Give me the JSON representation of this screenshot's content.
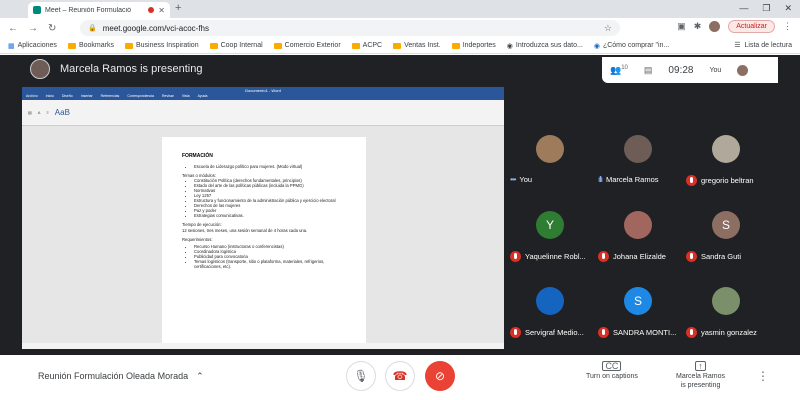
{
  "browser": {
    "tab_title": "Meet – Reunión Formulació",
    "url": "meet.google.com/vci-acoc-fhs",
    "update_label": "Actualizar"
  },
  "bookmarks": {
    "items": [
      "Aplicaciones",
      "Bookmarks",
      "Business Inspiration",
      "Coop Internal",
      "Comercio Exterior",
      "ACPC",
      "Ventas Inst.",
      "Indeportes",
      "Introduzca sus dato...",
      "¿Cómo comprar \"in..."
    ],
    "reading_list": "Lista de lectura"
  },
  "meet": {
    "presenting_text": "Marcela Ramos is presenting",
    "people_count": "10",
    "time": "09:28",
    "you_label": "You"
  },
  "document": {
    "app_title": "Documento1 - Word",
    "tabs": [
      "Archivo",
      "Inicio",
      "Diseño",
      "Insertar",
      "Referencias",
      "Correspondencia",
      "Revisar",
      "Vista",
      "Ayuda"
    ],
    "ribbon_big": "AaB",
    "heading": "FORMACIÓN",
    "intro_bullet": "Escuela de Liderazgo político para mujeres. (Modo virtual)",
    "topics_title": "Temas o módulos:",
    "topics": [
      "Constitución Política (derechos fundamentales, principios)",
      "Estado del arte de las políticas públicas (incluida la PPMG)",
      "Normativas",
      "Ley 1257",
      "Estructura y funcionamiento de la administración pública y ejercicio electoral",
      "Derechos de las mujeres",
      "Paz y poder",
      "Estrategias comunicativas."
    ],
    "time_title": "Tiempo de ejecución:",
    "time_text": "12 sesiones, tres meses, una sesión semanal de 4 horas cada una.",
    "req_title": "Requerimientos:",
    "requirements": [
      "Recurso Humano (instructoras o conferencistas)",
      "Coordinadora logística",
      "Publicidad para convocatoria",
      "Temas logísticos (transporte, sitio o plataforma, materiales, refrigerios, certificaciones, etc)."
    ]
  },
  "participants": [
    {
      "name": "You",
      "initial": "",
      "color": "#9e7b5a",
      "muted": false
    },
    {
      "name": "Marcela Ramos",
      "initial": "",
      "color": "#6d5d56",
      "muted": false
    },
    {
      "name": "gregorio beltran",
      "initial": "",
      "color": "#b0a89a",
      "muted": true
    },
    {
      "name": "Yaquelinne Robl...",
      "initial": "Y",
      "color": "#2e7d32",
      "muted": true
    },
    {
      "name": "Johana Elizalde",
      "initial": "",
      "color": "#a1665e",
      "muted": true
    },
    {
      "name": "Sandra Guti",
      "initial": "S",
      "color": "#8d6e63",
      "muted": true
    },
    {
      "name": "Servigraf Medio...",
      "initial": "",
      "color": "#1565c0",
      "muted": true
    },
    {
      "name": "SANDRA MONTI...",
      "initial": "S",
      "color": "#1e88e5",
      "muted": true
    },
    {
      "name": "yasmin gonzalez",
      "initial": "",
      "color": "#7b8f6a",
      "muted": true
    }
  ],
  "bottom": {
    "meeting_title": "Reunión Formulación Oleada Morada",
    "captions_label": "Turn on captions",
    "captions_icon": "CC",
    "presenting_label_1": "Marcela Ramos",
    "presenting_label_2": "is presenting"
  },
  "colors": {
    "meet_bg": "#202124",
    "hangup": "#d93025",
    "cam_off": "#ea4335",
    "word_blue": "#2b579a"
  }
}
